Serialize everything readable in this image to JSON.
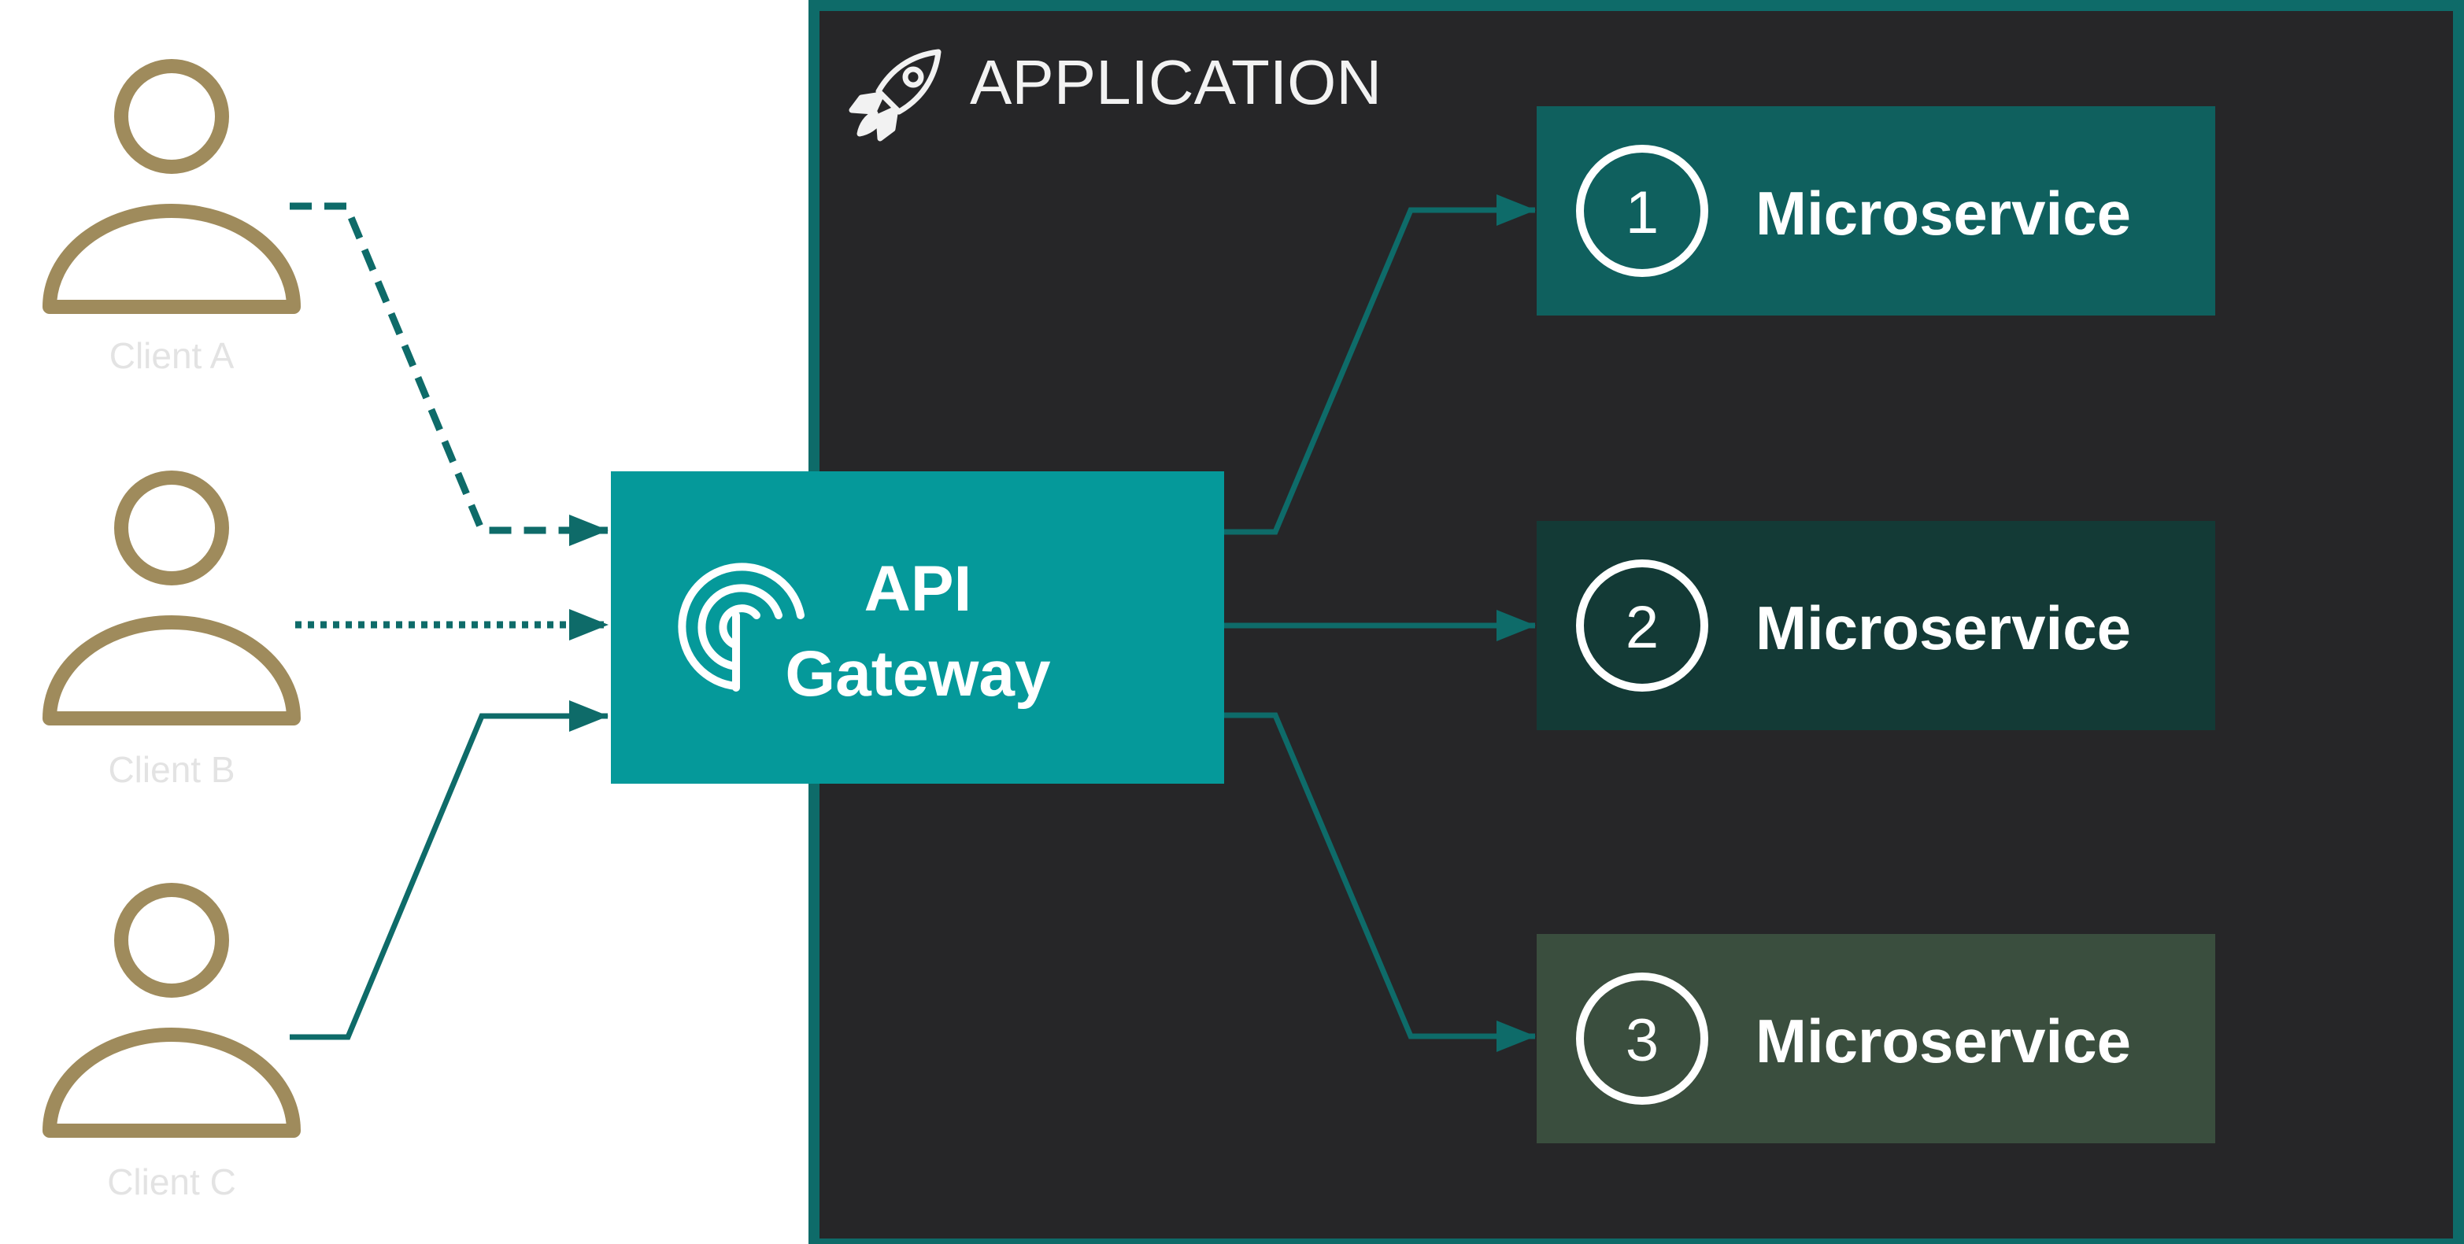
{
  "application": {
    "title": "APPLICATION",
    "icon": "rocket-icon"
  },
  "gateway": {
    "line1": "API",
    "line2": "Gateway",
    "icon": "broadcast-signal-icon"
  },
  "clients": [
    {
      "label": "Client A",
      "connection": "dashed"
    },
    {
      "label": "Client B",
      "connection": "dotted"
    },
    {
      "label": "Client C",
      "connection": "solid"
    }
  ],
  "microservices": [
    {
      "number": "1",
      "label": "Microservice",
      "color": "#0f605e"
    },
    {
      "number": "2",
      "label": "Microservice",
      "color": "#133a36"
    },
    {
      "number": "3",
      "label": "Microservice",
      "color": "#3a4e3e"
    }
  ],
  "colors": {
    "app_background": "#262628",
    "app_border": "#0e6b69",
    "gateway": "#05999a",
    "connector": "#0e6b69",
    "client_icon": "#9f8b5c",
    "client_label": "#e3e3e3"
  }
}
